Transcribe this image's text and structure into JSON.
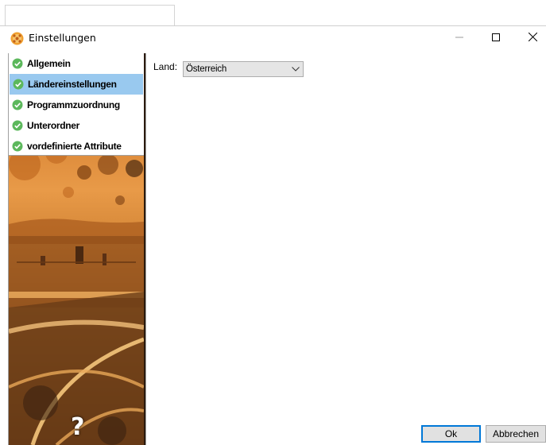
{
  "window": {
    "title": "Einstellungen",
    "icon": "settings-app-icon",
    "controls": [
      "minimize-icon",
      "maximize-icon",
      "close-icon"
    ]
  },
  "sidebar": {
    "items": [
      {
        "label": "Allgemein",
        "icon": "check-circle-icon",
        "selected": false
      },
      {
        "label": "Ländereinstellungen",
        "icon": "check-circle-icon",
        "selected": true
      },
      {
        "label": "Programmzuordnung",
        "icon": "check-circle-icon",
        "selected": false
      },
      {
        "label": "Unterordner",
        "icon": "check-circle-icon",
        "selected": false
      },
      {
        "label": "vordefinierte Attribute",
        "icon": "check-circle-icon",
        "selected": false
      }
    ],
    "help_glyph": "?"
  },
  "main": {
    "land_label": "Land:",
    "country_select": {
      "value": "Österreich"
    }
  },
  "footer": {
    "ok_label": "Ok",
    "cancel_label": "Abbrechen"
  },
  "colors": {
    "selection": "#99c9ef",
    "check_green": "#5cb85c",
    "accent_orange": "#e8953a"
  }
}
